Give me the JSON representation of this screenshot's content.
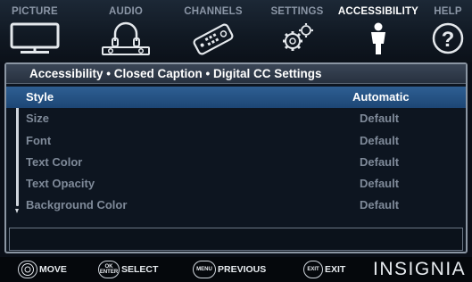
{
  "menu": {
    "tabs": [
      {
        "label": "PICTURE",
        "icon": "tv-icon"
      },
      {
        "label": "AUDIO",
        "icon": "headphones-icon"
      },
      {
        "label": "CHANNELS",
        "icon": "remote-icon"
      },
      {
        "label": "SETTINGS",
        "icon": "gears-icon"
      },
      {
        "label": "ACCESSIBILITY",
        "icon": "person-icon"
      },
      {
        "label": "HELP",
        "icon": "question-icon"
      }
    ],
    "active": "ACCESSIBILITY"
  },
  "panel": {
    "breadcrumb": "Accessibility  • Closed Caption • Digital CC Settings",
    "rows": [
      {
        "label": "Style",
        "value": "Automatic",
        "selected": true
      },
      {
        "label": "Size",
        "value": "Default"
      },
      {
        "label": "Font",
        "value": "Default"
      },
      {
        "label": "Text Color",
        "value": "Default"
      },
      {
        "label": "Text Opacity",
        "value": "Default"
      },
      {
        "label": "Background Color",
        "value": "Default"
      }
    ]
  },
  "hints": {
    "move": {
      "label": "MOVE"
    },
    "select": {
      "button": "OK ENTER",
      "label": "SELECT"
    },
    "previous": {
      "button": "MENU",
      "label": "PREVIOUS"
    },
    "exit": {
      "button": "EXIT",
      "label": "EXIT"
    }
  },
  "brand": "INSIGNIA",
  "colors": {
    "selected_row": "#2e5f93",
    "text_dim": "#7f8a99",
    "text_active": "#ffffff"
  }
}
